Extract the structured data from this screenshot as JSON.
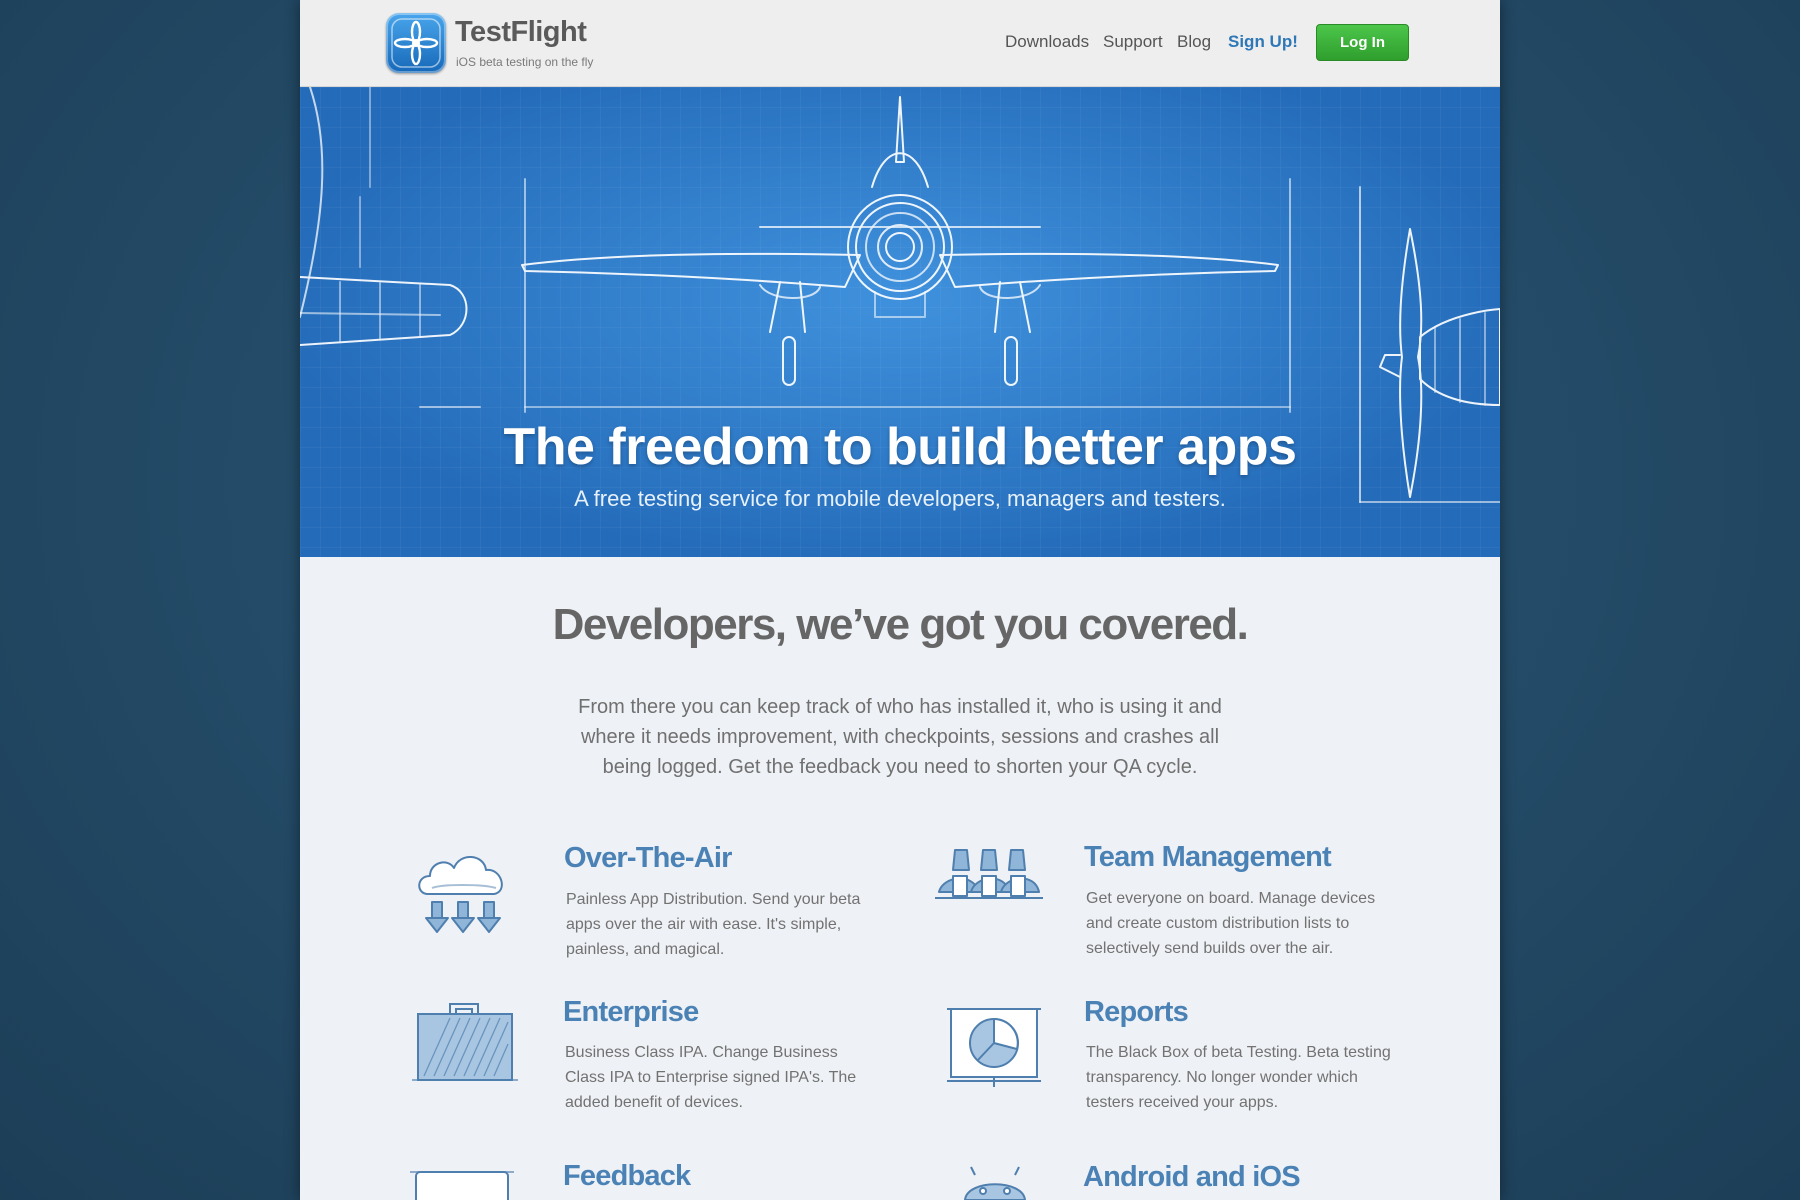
{
  "header": {
    "brand_name": "TestFlight",
    "brand_tagline": "iOS beta testing on the fly",
    "nav": {
      "downloads": "Downloads",
      "support": "Support",
      "blog": "Blog",
      "signup": "Sign Up!"
    },
    "login_label": "Log In"
  },
  "hero": {
    "title": "The freedom to build better apps",
    "subtitle": "A free testing service for mobile developers, managers and testers."
  },
  "developers": {
    "heading": "Developers, we’ve got you covered.",
    "description": "From there you can keep track of who has installed it, who is using it and where it needs improvement, with checkpoints,  sessions and crashes all being logged. Get the feedback you need to shorten your QA cycle."
  },
  "features": {
    "over_the_air": {
      "title": "Over-The-Air",
      "description": "Painless App Distribution. Send your beta apps over the air with ease. It's simple, painless, and magical.",
      "icon": "cloud-download-icon"
    },
    "team_management": {
      "title": "Team Management",
      "description": "Get everyone on board. Manage devices and create custom distribution lists to selectively send builds over the air.",
      "icon": "team-icon"
    },
    "enterprise": {
      "title": "Enterprise",
      "description": "Business Class IPA. Change Business Class IPA to Enterprise signed IPA's. The added benefit of devices.",
      "icon": "briefcase-icon"
    },
    "reports": {
      "title": "Reports",
      "description": "The Black Box of beta Testing. Beta testing transparency. No longer wonder which testers received your apps.",
      "icon": "presentation-chart-icon"
    },
    "feedback": {
      "title": "Feedback",
      "icon": "feedback-window-icon"
    },
    "android_ios": {
      "title": "Android and iOS",
      "icon": "android-icon"
    }
  },
  "colors": {
    "background": "#234a66",
    "hero_blue": "#2c7fcc",
    "feature_title": "#4b82b6",
    "login_green": "#3bb33a",
    "signup_link": "#2f78b7"
  }
}
